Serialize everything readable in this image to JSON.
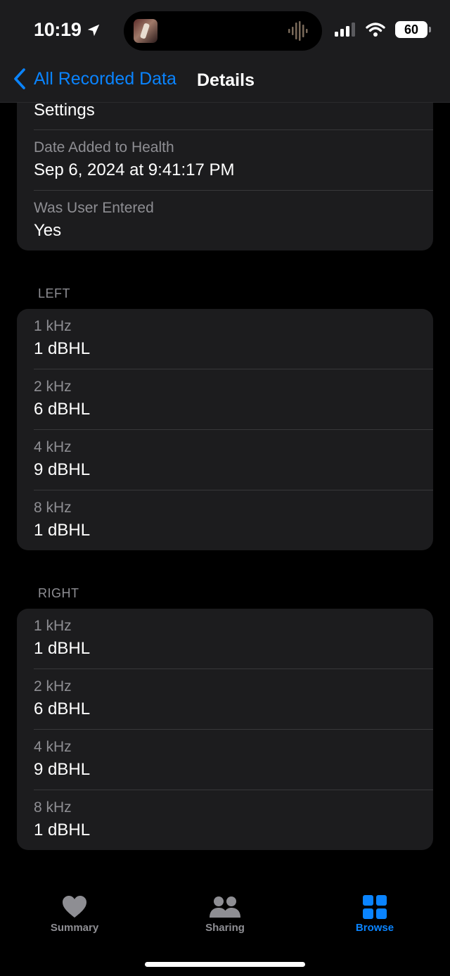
{
  "status": {
    "time": "10:19",
    "battery": "60"
  },
  "nav": {
    "back_label": "All Recorded Data",
    "title": "Details"
  },
  "meta": {
    "settings_label": "Settings",
    "rows": [
      {
        "label": "Date Added to Health",
        "value": "Sep 6, 2024 at 9:41:17 PM"
      },
      {
        "label": "Was User Entered",
        "value": "Yes"
      }
    ]
  },
  "left": {
    "header": "LEFT",
    "rows": [
      {
        "label": "1 kHz",
        "value": "1 dBHL"
      },
      {
        "label": "2 kHz",
        "value": "6 dBHL"
      },
      {
        "label": "4 kHz",
        "value": "9 dBHL"
      },
      {
        "label": "8 kHz",
        "value": "1 dBHL"
      }
    ]
  },
  "right": {
    "header": "RIGHT",
    "rows": [
      {
        "label": "1 kHz",
        "value": "1 dBHL"
      },
      {
        "label": "2 kHz",
        "value": "6 dBHL"
      },
      {
        "label": "4 kHz",
        "value": "9 dBHL"
      },
      {
        "label": "8 kHz",
        "value": "1 dBHL"
      }
    ]
  },
  "tabs": [
    {
      "label": "Summary",
      "icon": "heart-icon",
      "active": false
    },
    {
      "label": "Sharing",
      "icon": "people-icon",
      "active": false
    },
    {
      "label": "Browse",
      "icon": "grid-icon",
      "active": true
    }
  ],
  "colors": {
    "accent": "#0a84ff",
    "card": "#1c1c1e",
    "background": "#000000",
    "secondary_text": "#8e8e93"
  }
}
